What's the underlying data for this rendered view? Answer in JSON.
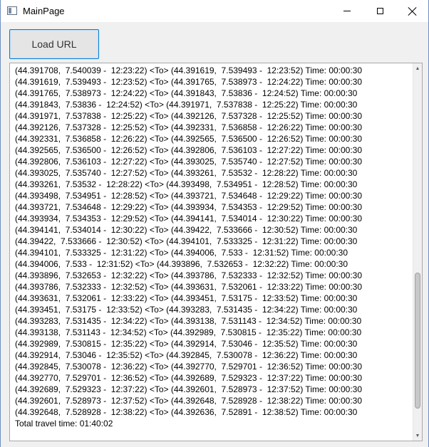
{
  "window": {
    "title": "MainPage"
  },
  "toolbar": {
    "load_url_label": "Load URL"
  },
  "output": {
    "lines": [
      "(44.391708,  7.540039 -  12:23:22) <To> (44.391619,  7.539493 -  12:23:52) Time: 00:00:30",
      "(44.391619,  7.539493 -  12:23:52) <To> (44.391765,  7.538973 -  12:24:22) Time: 00:00:30",
      "(44.391765,  7.538973 -  12:24:22) <To> (44.391843,  7.53836 -  12:24:52) Time: 00:00:30",
      "(44.391843,  7.53836 -  12:24:52) <To> (44.391971,  7.537838 -  12:25:22) Time: 00:00:30",
      "(44.391971,  7.537838 -  12:25:22) <To> (44.392126,  7.537328 -  12:25:52) Time: 00:00:30",
      "(44.392126,  7.537328 -  12:25:52) <To> (44.392331,  7.536858 -  12:26:22) Time: 00:00:30",
      "(44.392331,  7.536858 -  12:26:22) <To> (44.392565,  7.536500 -  12:26:52) Time: 00:00:30",
      "(44.392565,  7.536500 -  12:26:52) <To> (44.392806,  7.536103 -  12:27:22) Time: 00:00:30",
      "(44.392806,  7.536103 -  12:27:22) <To> (44.393025,  7.535740 -  12:27:52) Time: 00:00:30",
      "(44.393025,  7.535740 -  12:27:52) <To> (44.393261,  7.53532 -  12:28:22) Time: 00:00:30",
      "(44.393261,  7.53532 -  12:28:22) <To> (44.393498,  7.534951 -  12:28:52) Time: 00:00:30",
      "(44.393498,  7.534951 -  12:28:52) <To> (44.393721,  7.534648 -  12:29:22) Time: 00:00:30",
      "(44.393721,  7.534648 -  12:29:22) <To> (44.393934,  7.534353 -  12:29:52) Time: 00:00:30",
      "(44.393934,  7.534353 -  12:29:52) <To> (44.394141,  7.534014 -  12:30:22) Time: 00:00:30",
      "(44.394141,  7.534014 -  12:30:22) <To> (44.39422,  7.533666 -  12:30:52) Time: 00:00:30",
      "(44.39422,  7.533666 -  12:30:52) <To> (44.394101,  7.533325 -  12:31:22) Time: 00:00:30",
      "(44.394101,  7.533325 -  12:31:22) <To> (44.394006,  7.533 -  12:31:52) Time: 00:00:30",
      "(44.394006,  7.533 -  12:31:52) <To> (44.393896,  7.532653 -  12:32:22) Time: 00:00:30",
      "(44.393896,  7.532653 -  12:32:22) <To> (44.393786,  7.532333 -  12:32:52) Time: 00:00:30",
      "(44.393786,  7.532333 -  12:32:52) <To> (44.393631,  7.532061 -  12:33:22) Time: 00:00:30",
      "(44.393631,  7.532061 -  12:33:22) <To> (44.393451,  7.53175 -  12:33:52) Time: 00:00:30",
      "(44.393451,  7.53175 -  12:33:52) <To> (44.393283,  7.531435 -  12:34:22) Time: 00:00:30",
      "(44.393283,  7.531435 -  12:34:22) <To> (44.393138,  7.531143 -  12:34:52) Time: 00:00:30",
      "(44.393138,  7.531143 -  12:34:52) <To> (44.392989,  7.530815 -  12:35:22) Time: 00:00:30",
      "(44.392989,  7.530815 -  12:35:22) <To> (44.392914,  7.53046 -  12:35:52) Time: 00:00:30",
      "(44.392914,  7.53046 -  12:35:52) <To> (44.392845,  7.530078 -  12:36:22) Time: 00:00:30",
      "(44.392845,  7.530078 -  12:36:22) <To> (44.392770,  7.529701 -  12:36:52) Time: 00:00:30",
      "(44.392770,  7.529701 -  12:36:52) <To> (44.392689,  7.529323 -  12:37:22) Time: 00:00:30",
      "(44.392689,  7.529323 -  12:37:22) <To> (44.392601,  7.528973 -  12:37:52) Time: 00:00:30",
      "(44.392601,  7.528973 -  12:37:52) <To> (44.392648,  7.528928 -  12:38:22) Time: 00:00:30",
      "(44.392648,  7.528928 -  12:38:22) <To> (44.392636,  7.52891 -  12:38:52) Time: 00:00:30",
      "Total travel time: 01:40:02"
    ],
    "scroll_position": 0.9,
    "visible_fraction": 0.38
  },
  "icons": {
    "app": "app-window-icon",
    "minimize": "minimize-icon",
    "maximize": "maximize-icon",
    "close": "close-icon",
    "scroll_up": "scroll-up-arrow-icon",
    "scroll_down": "scroll-down-arrow-icon"
  },
  "colors": {
    "button_border": "#0a7fd6",
    "window_border": "#6f8fbf"
  }
}
